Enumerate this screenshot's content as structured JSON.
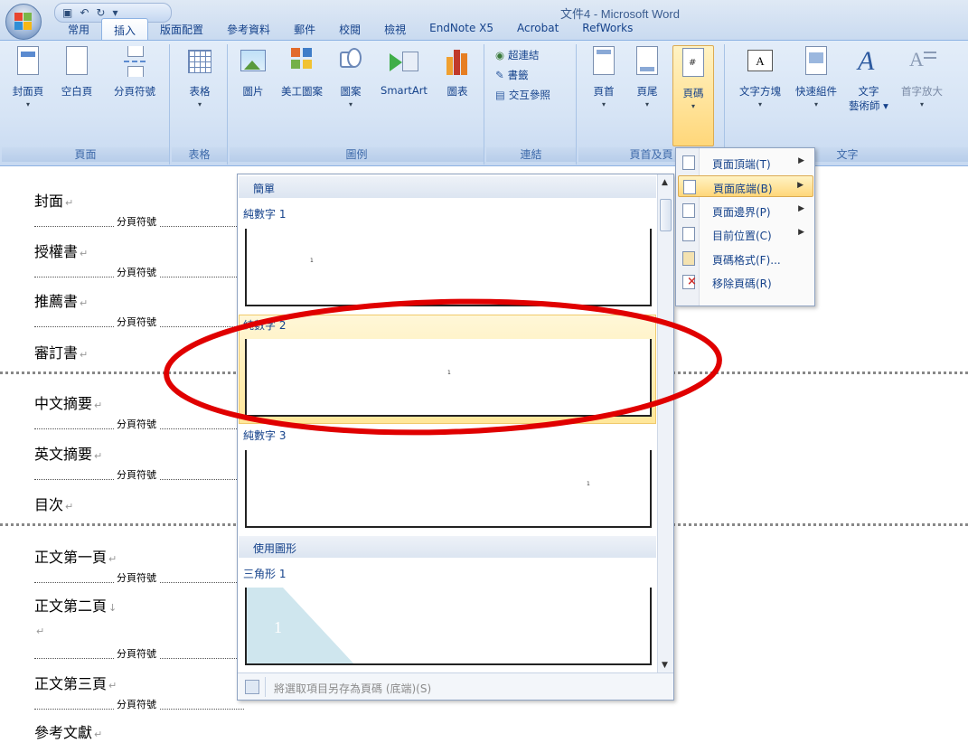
{
  "window": {
    "title": "文件4 - Microsoft Word",
    "qat_icons": [
      "save-icon",
      "undo-icon",
      "redo-icon",
      "customize-icon"
    ]
  },
  "tabs": [
    "常用",
    "插入",
    "版面配置",
    "參考資料",
    "郵件",
    "校閱",
    "檢視",
    "EndNote X5",
    "Acrobat",
    "RefWorks"
  ],
  "active_tab": "插入",
  "ribbon": {
    "groups": {
      "pages": {
        "label": "頁面",
        "buttons": [
          "封面頁",
          "空白頁",
          "分頁符號"
        ]
      },
      "tables": {
        "label": "表格",
        "buttons": [
          "表格"
        ]
      },
      "illustrations": {
        "label": "圖例",
        "buttons": [
          "圖片",
          "美工圖案",
          "圖案",
          "SmartArt",
          "圖表"
        ]
      },
      "links": {
        "label": "連結",
        "buttons": [
          "超連結",
          "書籤",
          "交互參照"
        ]
      },
      "header_footer": {
        "label": "頁首及頁",
        "buttons": [
          "頁首",
          "頁尾",
          "頁碼"
        ]
      },
      "text": {
        "label": "文字",
        "buttons": [
          "文字方塊",
          "快速組件",
          "文字",
          "藝術師",
          "首字放大"
        ]
      }
    }
  },
  "document": {
    "paragraphs": [
      "封面",
      "授權書",
      "推薦書",
      "審訂書",
      "中文摘要",
      "英文摘要",
      "目次",
      "正文第一頁",
      "正文第二頁",
      "正文第三頁",
      "參考文獻"
    ],
    "page_break_label": "分頁符號"
  },
  "gallery": {
    "categories": [
      "簡單",
      "使用圖形"
    ],
    "items": [
      "純數字 1",
      "純數字 2",
      "純數字 3",
      "三角形 1"
    ],
    "preview_number": "1",
    "footer_text": "將選取項目另存為頁碼 (底端)(S)"
  },
  "menu": {
    "items": [
      {
        "label": "頁面頂端(T)",
        "submenu": true
      },
      {
        "label": "頁面底端(B)",
        "submenu": true
      },
      {
        "label": "頁面邊界(P)",
        "submenu": true
      },
      {
        "label": "目前位置(C)",
        "submenu": true
      },
      {
        "label": "頁碼格式(F)...",
        "submenu": false
      },
      {
        "label": "移除頁碼(R)",
        "submenu": false
      }
    ],
    "highlighted": "頁面底端(B)"
  },
  "colors": {
    "annotation": "#e00000",
    "hover": "#ffe79a",
    "ribbon": "#d6e4f5"
  }
}
